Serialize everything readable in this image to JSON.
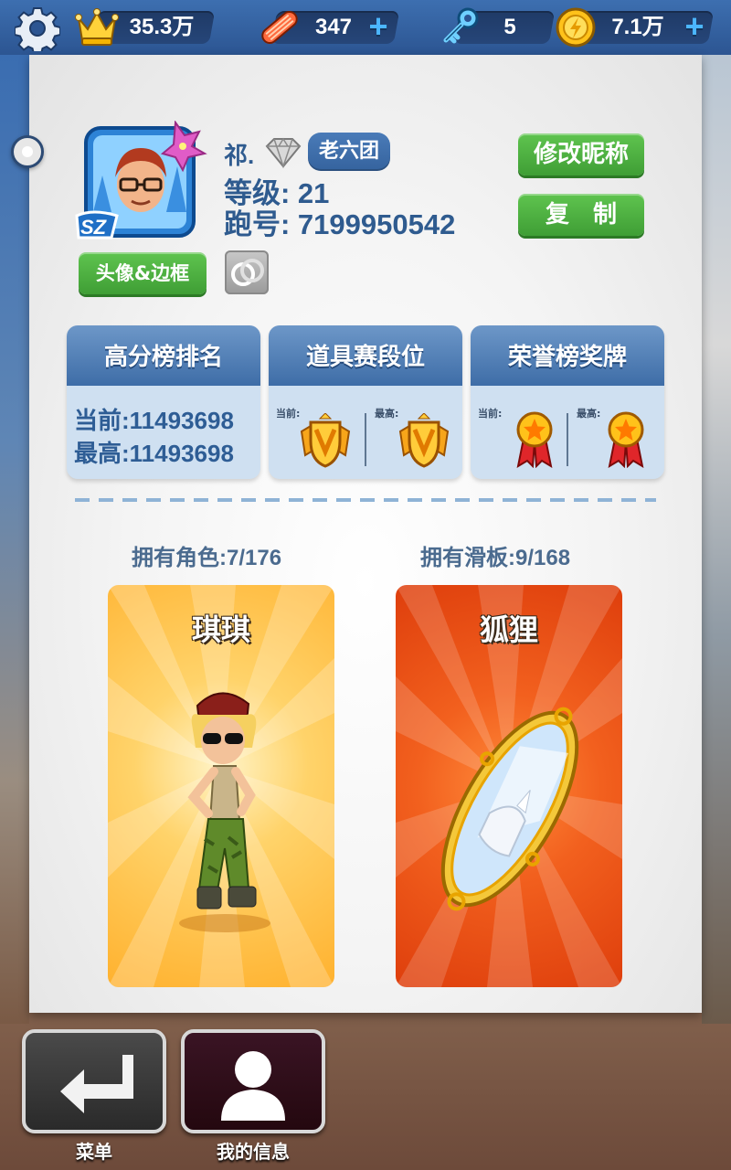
{
  "topbar": {
    "settings_icon": "gear-icon",
    "crown": {
      "icon": "crown-icon",
      "value": "35.3万"
    },
    "hoverboards": {
      "icon": "hoverboard-icon",
      "value": "347"
    },
    "keys": {
      "icon": "key-icon",
      "value": "5"
    },
    "coins": {
      "icon": "coin-icon",
      "value": "7.1万"
    },
    "plus": "+"
  },
  "profile": {
    "name": "祁.",
    "team": "老六团",
    "level_line": "等级: 21",
    "id_line": "跑号: 7199950542",
    "avatar_badge": "SZ",
    "rename_button": "修改昵称",
    "copy_button": "复　制",
    "avatar_frame_button": "头像&边框"
  },
  "stats": {
    "leaderboard": {
      "title": "高分榜排名",
      "current": "当前:11493698",
      "best": "最高:11493698"
    },
    "item_race": {
      "title": "道具赛段位",
      "current_label": "当前:",
      "best_label": "最高:"
    },
    "honor": {
      "title": "荣誉榜奖牌",
      "current_label": "当前:",
      "best_label": "最高:"
    }
  },
  "collection": {
    "characters_label": "拥有角色:7/176",
    "boards_label": "拥有滑板:9/168",
    "character_name": "琪琪",
    "board_name": "狐狸"
  },
  "bottom": {
    "menu_label": "菜单",
    "my_info_label": "我的信息"
  },
  "colors": {
    "accent_blue": "#2f5b8f",
    "green_button": "#4caf3f",
    "character_card": "#ffb63a",
    "board_card": "#e8501c"
  }
}
